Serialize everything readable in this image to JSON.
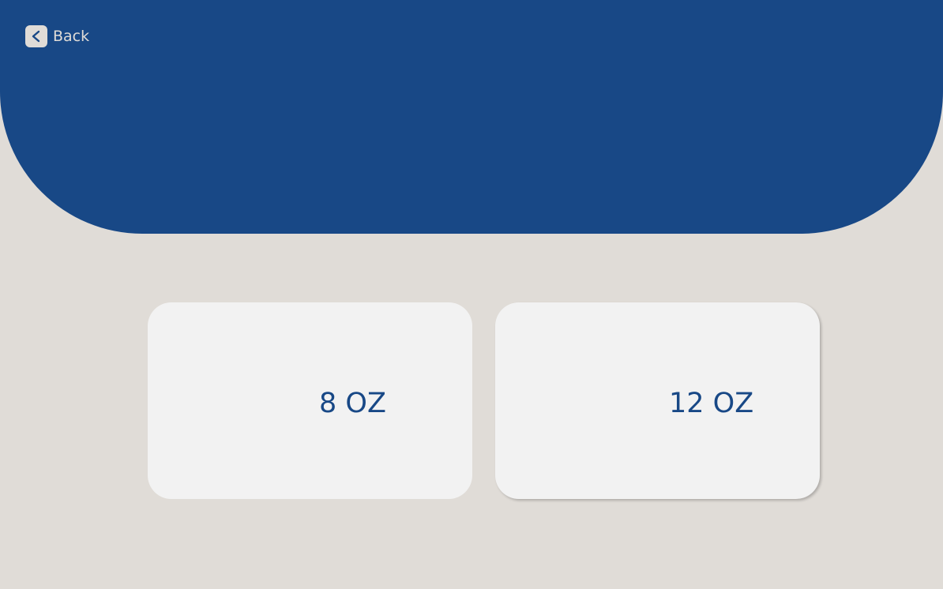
{
  "colors": {
    "header_background": "#184886",
    "page_background": "#e0dcd7",
    "card_background": "#f2f2f2",
    "label_text": "#184886"
  },
  "header": {
    "back_button": {
      "icon": "chevron-left-icon",
      "label": "Back"
    }
  },
  "sizes": [
    {
      "label": "8 OZ"
    },
    {
      "label": "12 OZ"
    }
  ]
}
